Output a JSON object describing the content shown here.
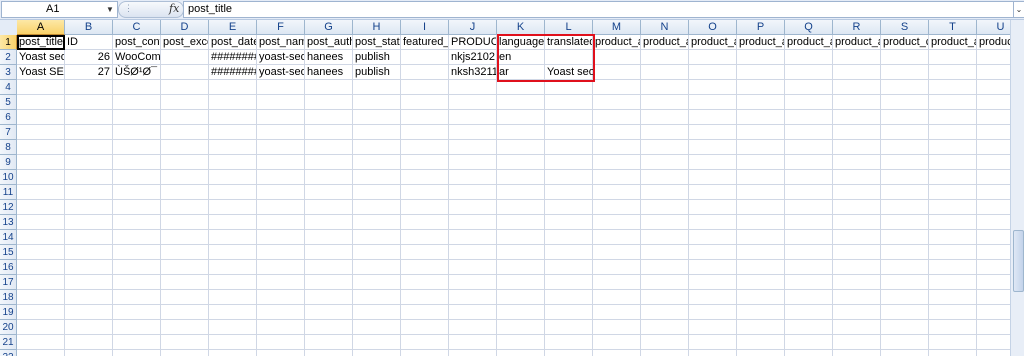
{
  "formula_bar": {
    "name_box": "A1",
    "fx_label": "fx",
    "formula_value": "post_title"
  },
  "sheet": {
    "columns": [
      "A",
      "B",
      "C",
      "D",
      "E",
      "F",
      "G",
      "H",
      "I",
      "J",
      "K",
      "L",
      "M",
      "N",
      "O",
      "P",
      "Q",
      "R",
      "S",
      "T",
      "U"
    ],
    "rows": [
      "1",
      "2",
      "3",
      "4",
      "5",
      "6",
      "7",
      "8",
      "9",
      "10",
      "11",
      "12",
      "13",
      "14",
      "15",
      "16",
      "17",
      "18",
      "19",
      "20",
      "21",
      "22"
    ],
    "active_cell": "A1",
    "highlighted_range": "K1:L3",
    "highlight_color": "#e0101c",
    "cells": {
      "A1": "post_title",
      "B1": "ID",
      "C1": "post_cont",
      "D1": "post_exce",
      "E1": "post_date",
      "F1": "post_nam",
      "G1": "post_auth",
      "H1": "post_statu",
      "I1": "featured_",
      "J1": "PRODUCT",
      "K1": "language_",
      "L1": "translated",
      "M1": "product_a",
      "N1": "product_a",
      "O1": "product_a",
      "P1": "product_a",
      "Q1": "product_a",
      "R1": "product_a",
      "S1": "product_c",
      "T1": "product_a",
      "U1": "produc",
      "A2": "Yoast seo",
      "B2": "26",
      "C2": "WooCom",
      "E2": "#########",
      "F2": "yoast-seo",
      "G2": "hanees",
      "H2": "publish",
      "J2": "nkjs2102",
      "K2": "en",
      "A3": "Yoast SEO",
      "B3": "27",
      "C3": "ÙŠØ¹Ø¯",
      "E3": "#########",
      "F3": "yoast-seo",
      "G3": "hanees",
      "H3": "publish",
      "J3": "nksh3211",
      "K3": "ar",
      "L3": "Yoast seo"
    },
    "numeric_cells": [
      "B2",
      "B3"
    ]
  }
}
